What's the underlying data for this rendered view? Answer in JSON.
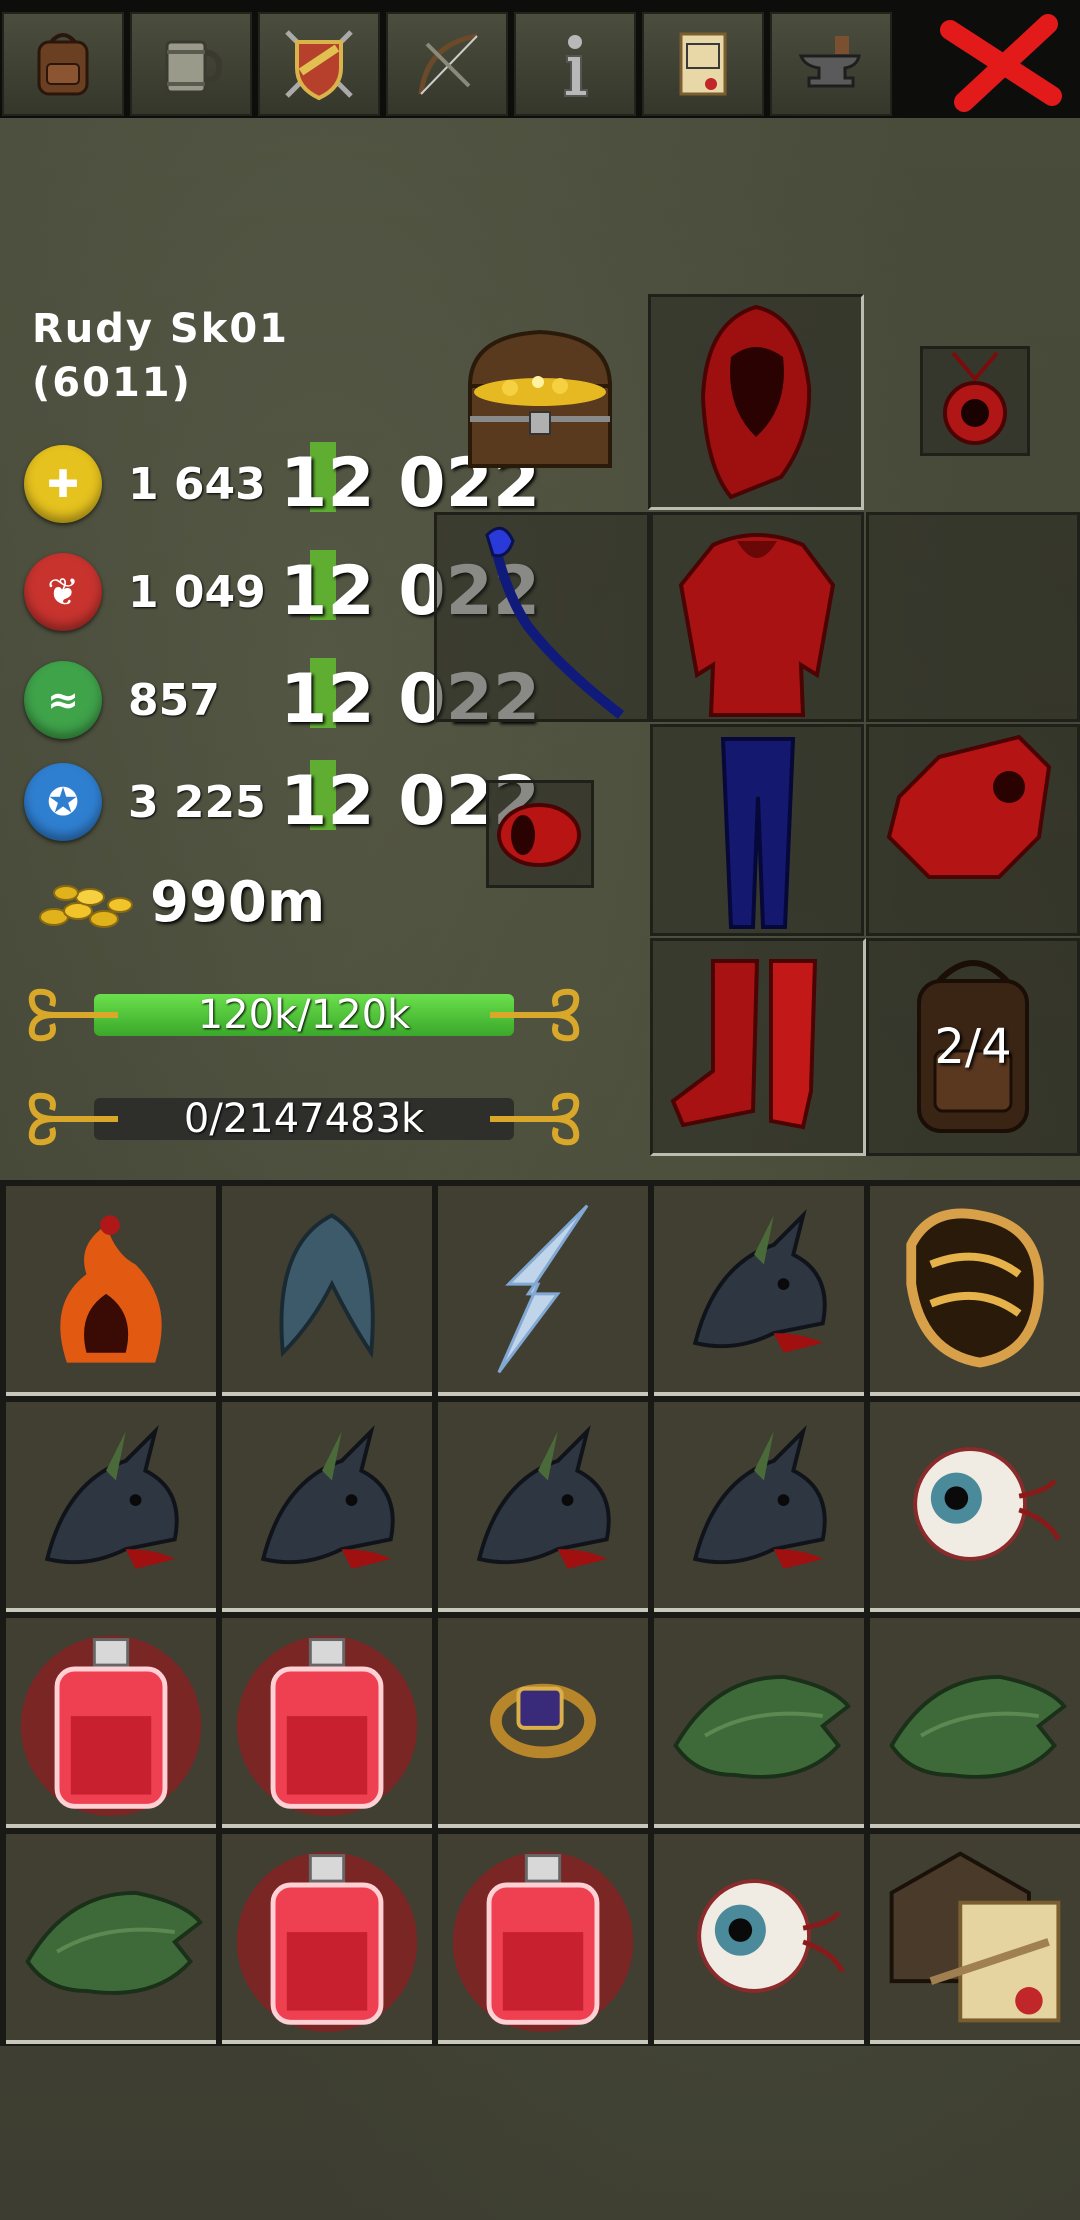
{
  "tabs": [
    {
      "name": "backpack",
      "icon": "backpack-icon"
    },
    {
      "name": "tavern",
      "icon": "tankard-icon"
    },
    {
      "name": "guild",
      "icon": "shield-swords-icon"
    },
    {
      "name": "skills",
      "icon": "bow-icon"
    },
    {
      "name": "info",
      "icon": "info-icon"
    },
    {
      "name": "quests",
      "icon": "scroll-icon"
    },
    {
      "name": "crafting",
      "icon": "anvil-icon"
    }
  ],
  "character": {
    "name": "Rudy Sk01",
    "level": "(6011)"
  },
  "stats": [
    {
      "icon": "strength-orb-icon",
      "value": "1 643",
      "overlay": "12 022",
      "color": "#e6c21e"
    },
    {
      "icon": "dexterity-orb-icon",
      "value": "1 049",
      "overlay": "12 022",
      "color": "#c8332e"
    },
    {
      "icon": "vitality-orb-icon",
      "value": "857",
      "overlay": "12 022",
      "color": "#3fa34a"
    },
    {
      "icon": "magic-orb-icon",
      "value": "3 225",
      "overlay": "12 022",
      "color": "#2f7fd1"
    }
  ],
  "gold": "990m",
  "health_bar": {
    "label": "120k/120k",
    "fill": 1.0,
    "color": "#4fc43a"
  },
  "xp_bar": {
    "label": "0/2147483k",
    "fill": 0.0,
    "color": "#3a3a35"
  },
  "backpack_slots": "2/4",
  "equipment": [
    "treasure-chest-icon",
    "red-hood-icon",
    "red-amulet-icon",
    "blue-staff-icon",
    "red-robe-icon",
    "empty-slot",
    "red-bracer-icon",
    "blue-pants-icon",
    "red-gloves-icon",
    "red-boots-icon",
    "backpack-slot-icon"
  ],
  "inventory": [
    [
      "flaming-figure-icon",
      "blue-hood-icon",
      "lightning-icon",
      "dragon-head-icon",
      "golden-armor-icon"
    ],
    [
      "dragon-head-icon",
      "dragon-head-icon",
      "dragon-head-icon",
      "dragon-head-icon",
      "eyeball-icon"
    ],
    [
      "red-potion-icon",
      "red-potion-icon",
      "gold-ring-icon",
      "green-scale-icon",
      "green-scale-icon"
    ],
    [
      "green-scale-icon",
      "red-potion-icon",
      "red-potion-icon",
      "eyeball-icon",
      "house-deed-icon"
    ]
  ]
}
